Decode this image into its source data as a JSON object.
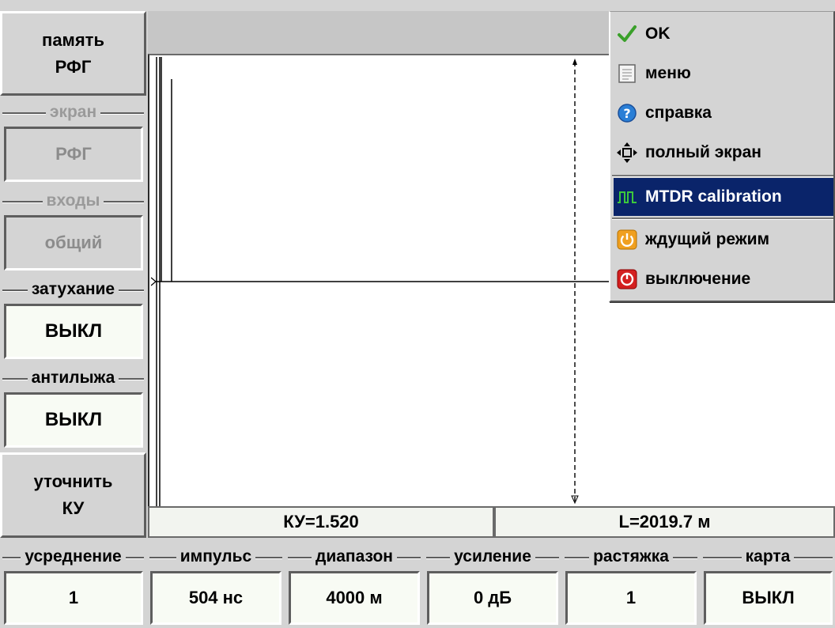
{
  "left_panel": {
    "memory_button": "память\nРФГ",
    "screen_group": "экран",
    "screen_value": "РФГ",
    "inputs_group": "входы",
    "inputs_value": "общий",
    "attenuation_group": "затухание",
    "attenuation_value": "ВЫКЛ",
    "antiski_group": "антилыжа",
    "antiski_value": "ВЫКЛ",
    "refine_button": "уточнить\nКУ"
  },
  "status": {
    "ku": "КУ=1.520",
    "length": "L=2019.7 м"
  },
  "bottom_controls": [
    {
      "label": "усреднение",
      "value": "1"
    },
    {
      "label": "импульс",
      "value": "504 нс"
    },
    {
      "label": "диапазон",
      "value": "4000 м"
    },
    {
      "label": "усиление",
      "value": "0 дБ"
    },
    {
      "label": "растяжка",
      "value": "1"
    },
    {
      "label": "карта",
      "value": "ВЫКЛ"
    }
  ],
  "context_menu": {
    "items": [
      {
        "label": "OK",
        "icon": "check-icon"
      },
      {
        "label": "меню",
        "icon": "document-icon"
      },
      {
        "label": "справка",
        "icon": "help-icon"
      },
      {
        "label": "полный экран",
        "icon": "move-arrows-icon"
      },
      {
        "label": "MTDR calibration",
        "icon": "pulse-wave-icon",
        "selected": true
      },
      {
        "label": "ждущий режим",
        "icon": "standby-icon"
      },
      {
        "label": "выключение",
        "icon": "power-off-icon"
      }
    ],
    "selected_color": "#0a246a"
  },
  "colors": {
    "panel": "#d4d4d4",
    "plot": "#ffffff",
    "trace": "#000000"
  }
}
